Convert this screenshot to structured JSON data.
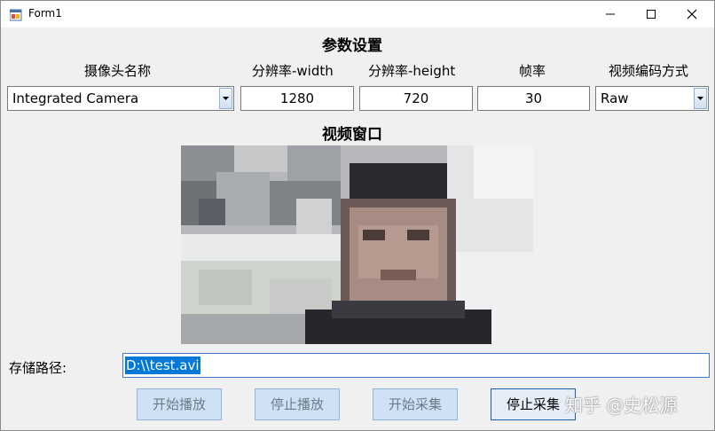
{
  "window": {
    "title": "Form1"
  },
  "settings": {
    "heading": "参数设置",
    "camera": {
      "label": "摄像头名称",
      "value": "Integrated Camera"
    },
    "width": {
      "label": "分辨率-width",
      "value": "1280"
    },
    "height": {
      "label": "分辨率-height",
      "value": "720"
    },
    "fps": {
      "label": "帧率",
      "value": "30"
    },
    "codec": {
      "label": "视频编码方式",
      "value": "Raw"
    }
  },
  "video": {
    "heading": "视频窗口"
  },
  "storage": {
    "label": "存储路径:",
    "path": "D:\\\\test.avi"
  },
  "buttons": {
    "start_play": "开始播放",
    "stop_play": "停止播放",
    "start_capture": "开始采集",
    "stop_capture": "停止采集"
  },
  "watermark": "知乎 @史松源",
  "icons": {
    "app": "form-icon",
    "minimize": "minimize-icon",
    "maximize": "maximize-icon",
    "close": "close-icon",
    "dropdown": "chevron-down-icon"
  }
}
